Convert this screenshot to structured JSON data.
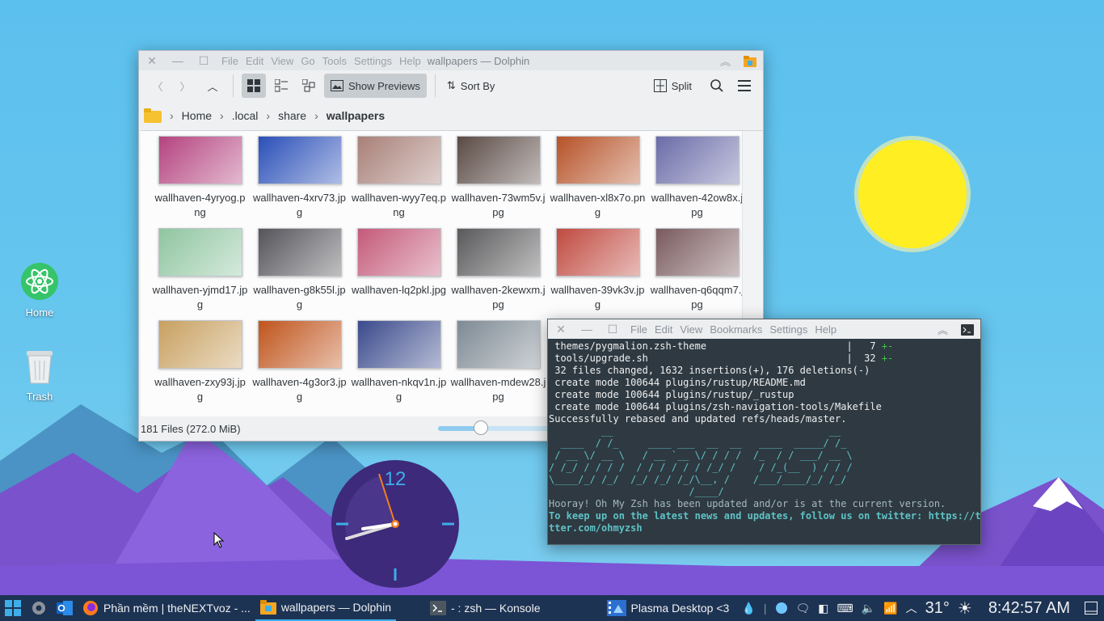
{
  "desktop": {
    "icons": [
      {
        "label": "Home"
      },
      {
        "label": "Trash"
      }
    ],
    "clock_number": "12"
  },
  "dolphin": {
    "menu": [
      "File",
      "Edit",
      "View",
      "Go",
      "Tools",
      "Settings",
      "Help"
    ],
    "title": "wallpapers — Dolphin",
    "toolbar": {
      "show_previews": "Show Previews",
      "sort_by": "Sort By",
      "split": "Split"
    },
    "breadcrumb": [
      "Home",
      ".local",
      "share",
      "wallpapers"
    ],
    "files": [
      {
        "name": "wallhaven-4yryog.png",
        "color": "#b4437f"
      },
      {
        "name": "wallhaven-4xrv73.jpg",
        "color": "#2a4fb8"
      },
      {
        "name": "wallhaven-wyy7eq.png",
        "color": "#a88078"
      },
      {
        "name": "wallhaven-73wm5v.jpg",
        "color": "#5a4a44"
      },
      {
        "name": "wallhaven-xl8x7o.png",
        "color": "#b65228"
      },
      {
        "name": "wallhaven-42ow8x.jpg",
        "color": "#6a6ca8"
      },
      {
        "name": "wallhaven-yjmd17.jpg",
        "color": "#8fc5a0"
      },
      {
        "name": "wallhaven-g8k55l.jpg",
        "color": "#55545a"
      },
      {
        "name": "wallhaven-lq2pkl.jpg",
        "color": "#c45a7a"
      },
      {
        "name": "wallhaven-2kewxm.jpg",
        "color": "#59585a"
      },
      {
        "name": "wallhaven-39vk3v.jpg",
        "color": "#c04a40"
      },
      {
        "name": "wallhaven-q6qqm7.jpg",
        "color": "#7a5a5e"
      },
      {
        "name": "wallhaven-zxy93j.jpg",
        "color": "#c8a060"
      },
      {
        "name": "wallhaven-4g3or3.jpg",
        "color": "#c0541c"
      },
      {
        "name": "wallhaven-nkqv1n.jpg",
        "color": "#3a4a8c"
      },
      {
        "name": "wallhaven-mdew28.jpg",
        "color": "#7e8a94"
      }
    ],
    "status": "181 Files (272.0 MiB)",
    "zoom_level": 0.35
  },
  "konsole": {
    "menu": [
      "File",
      "Edit",
      "View",
      "Bookmarks",
      "Settings",
      "Help"
    ],
    "lines": [
      {
        "text": " themes/pygmalion.zsh-theme                        |   7 ",
        "suffix": "+-",
        "cls": ""
      },
      {
        "text": " tools/upgrade.sh                                  |  32 ",
        "suffix": "+-",
        "cls": ""
      },
      {
        "text": " 32 files changed, 1632 insertions(+), 176 deletions(-)",
        "suffix": "",
        "cls": ""
      },
      {
        "text": " create mode 100644 plugins/rustup/README.md",
        "suffix": "",
        "cls": ""
      },
      {
        "text": " create mode 100644 plugins/rustup/_rustup",
        "suffix": "",
        "cls": ""
      },
      {
        "text": " create mode 100644 plugins/zsh-navigation-tools/Makefile",
        "suffix": "",
        "cls": ""
      },
      {
        "text": "Successfully rebased and updated refs/heads/master.",
        "suffix": "",
        "cls": ""
      },
      {
        "text": "         __                                     __",
        "suffix": "",
        "cls": "teal"
      },
      {
        "text": "  ____  / /_     ____ ___  __  __   ____  _____/ /_",
        "suffix": "",
        "cls": "teal"
      },
      {
        "text": " / __ \\/ __ \\   / __ `__ \\/ / / /  /_  / / ___/ __ \\",
        "suffix": "",
        "cls": "teal"
      },
      {
        "text": "/ /_/ / / / /  / / / / / / /_/ /    / /_(__  ) / / /",
        "suffix": "",
        "cls": "teal"
      },
      {
        "text": "\\____/_/ /_/  /_/ /_/ /_/\\__, /    /___/____/_/ /_/",
        "suffix": "",
        "cls": "teal"
      },
      {
        "text": "                        /____/",
        "suffix": "",
        "cls": "teal"
      },
      {
        "text": "Hooray! Oh My Zsh has been updated and/or is at the current version.",
        "suffix": "",
        "cls": "gray"
      },
      {
        "text": "To keep up on the latest news and updates, follow us on twitter: https://twi",
        "suffix": "",
        "cls": "bold"
      },
      {
        "text": "tter.com/ohmyzsh",
        "suffix": "",
        "cls": "bold"
      }
    ]
  },
  "taskbar": {
    "tasks": [
      {
        "label": "Phần mềm | theNEXTvoz - ..."
      },
      {
        "label": "wallpapers — Dolphin"
      },
      {
        "label": "- : zsh — Konsole"
      },
      {
        "label": "Plasma Desktop <3"
      }
    ],
    "temperature": "31°",
    "time": "8:42:57 AM"
  },
  "colors": {
    "accent": "#3daee9",
    "taskbar": "#1d3354",
    "konsole_bg": "#2e3941"
  }
}
